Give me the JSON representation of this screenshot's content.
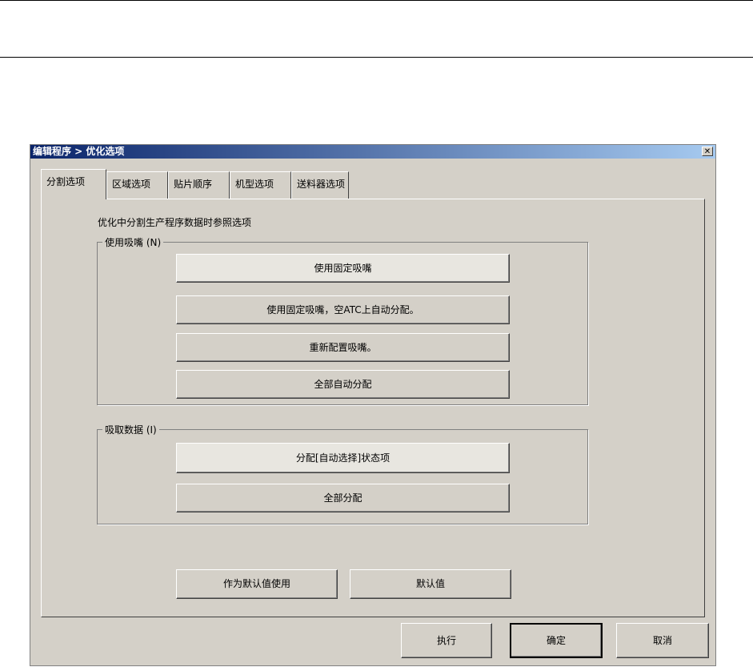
{
  "dialog": {
    "title": "编辑程序 > 优化选项",
    "close": "✕"
  },
  "tabs": [
    "分割选项",
    "区域选项",
    "贴片顺序",
    "机型选项",
    "送料器选项"
  ],
  "description": "优化中分割生产程序数据时参照选项",
  "nozzle_group": {
    "label": "使用吸嘴 (N)",
    "buttons": [
      "使用固定吸嘴",
      "使用固定吸嘴，空ATC上自动分配。",
      "重新配置吸嘴。",
      "全部自动分配"
    ]
  },
  "pickup_group": {
    "label": "吸取数据 (I)",
    "buttons": [
      "分配[自动选择]状态项",
      "全部分配"
    ]
  },
  "default_buttons": [
    "作为默认值使用",
    "默认值"
  ],
  "footer": {
    "execute": "执行",
    "ok": "确定",
    "cancel": "取消"
  }
}
